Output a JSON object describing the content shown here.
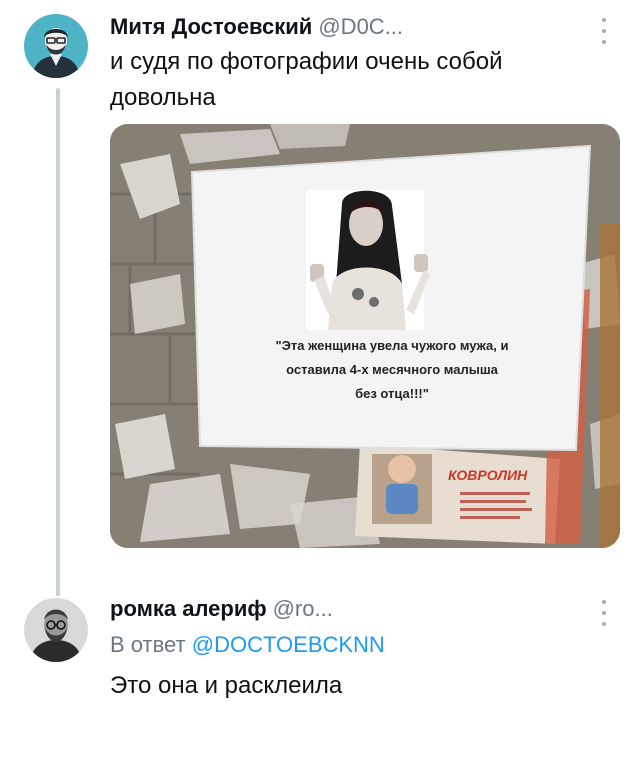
{
  "tweet1": {
    "author_name": "Митя Достоевский",
    "author_handle": "@D0C...",
    "text_line1": "и судя по фотографии очень собой",
    "text_line2": "довольна",
    "media": {
      "poster_text_line1": "\"Эта женщина увела чужого мужа, и",
      "poster_text_line2": "оставила 4-х месячного малыша",
      "poster_text_line3": "без отца!!!\"",
      "ad_brand": "КОВРОЛИН"
    }
  },
  "tweet2": {
    "author_name": "ромка алериф",
    "author_handle": "@ro...",
    "reply_prefix": "В ответ",
    "reply_mention": "@DOCTOEBCKNN",
    "text": "Это она и расклеила"
  },
  "icons": {
    "more": "more-vertical-icon"
  },
  "colors": {
    "accent": "#1d9bf0",
    "secondary_text": "#6b7780",
    "thread_line": "#c9d1d8"
  }
}
